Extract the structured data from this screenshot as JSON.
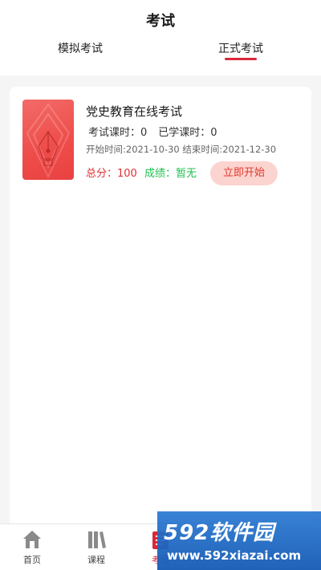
{
  "header": {
    "title": "考试",
    "tabs": [
      {
        "label": "模拟考试",
        "active": false
      },
      {
        "label": "正式考试",
        "active": true
      }
    ]
  },
  "exam_card": {
    "name": "党史教育在线考试",
    "exam_hours": "考试课时：0",
    "studied_hours": "已学课时：0",
    "times": "开始时间:2021-10-30  结束时间:2021-12-30",
    "total_score": "总分：100",
    "grade": "成绩：暂无",
    "start_button": "立即开始"
  },
  "bottom_nav": {
    "items": [
      {
        "label": "首页",
        "icon": "home-icon"
      },
      {
        "label": "课程",
        "icon": "books-icon"
      },
      {
        "label": "考试",
        "icon": "exam-icon",
        "active": true
      }
    ]
  },
  "watermark": {
    "brand": "592软件园",
    "url": "www.592xiazai.com"
  },
  "colors": {
    "accent": "#d8283a",
    "score": "#e03030",
    "grade": "#1fbf4f",
    "button_bg": "#fcd4cf"
  }
}
